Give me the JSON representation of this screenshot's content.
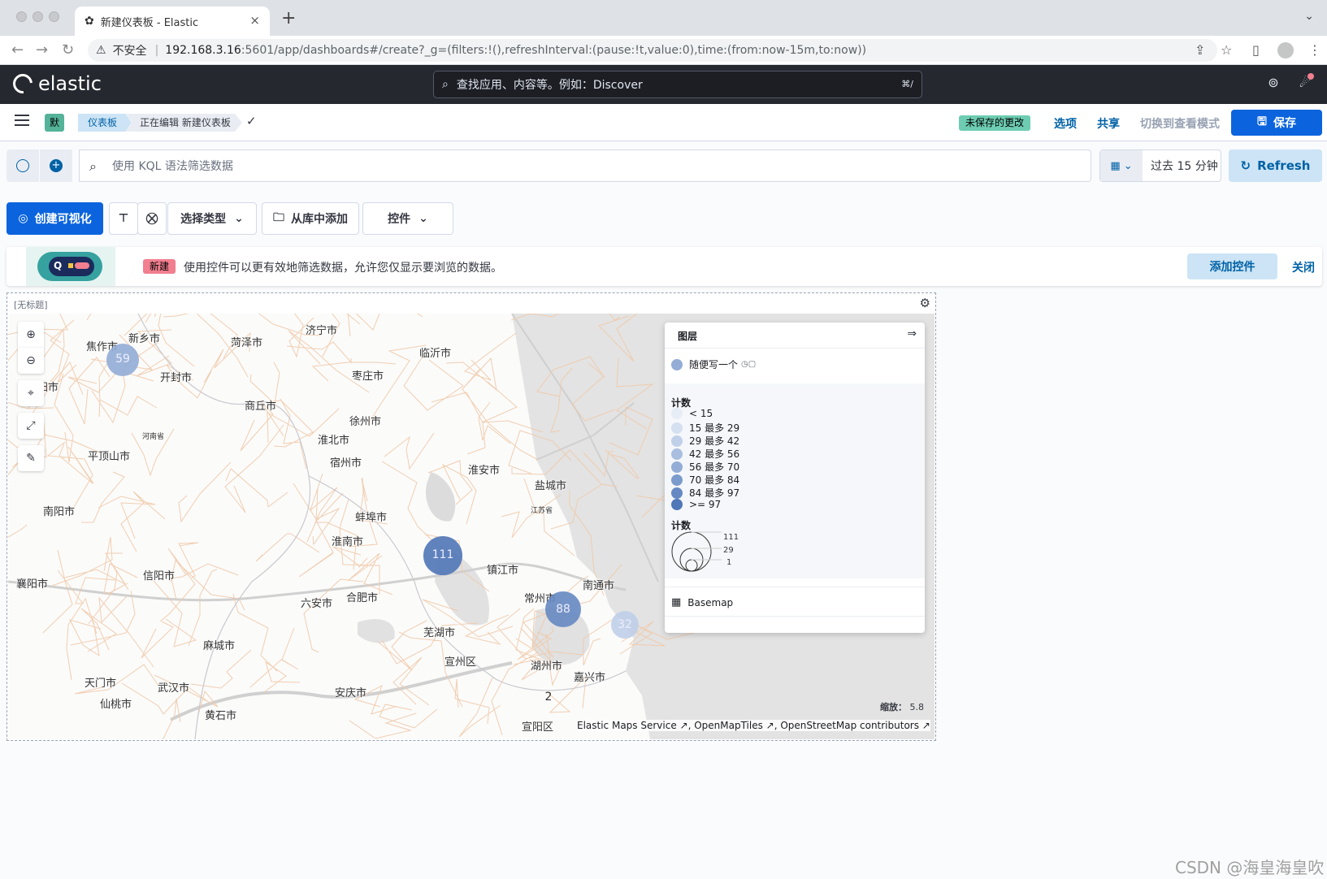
{
  "browser": {
    "tab_title": "新建仪表板 - Elastic",
    "tab_close": "×",
    "new_tab": "+",
    "security_label": "不安全",
    "url_host": "192.168.3.16",
    "url_path": ":5601/app/dashboards#/create?_g=(filters:!(),refreshInterval:(pause:!t,value:0),time:(from:now-15m,to:now))"
  },
  "kibana": {
    "logo_text": "elastic",
    "search_placeholder": "查找应用、内容等。例如：Discover",
    "search_shortcut": "⌘/"
  },
  "breadcrumb": {
    "space": "默",
    "dashboards": "仪表板",
    "current": "正在编辑 新建仪表板",
    "unsaved_badge": "未保存的更改",
    "options": "选项",
    "share": "共享",
    "switch_view": "切换到查看模式",
    "save": "保存"
  },
  "query": {
    "placeholder": "使用 KQL 语法筛选数据",
    "time_range": "过去 15 分钟",
    "refresh": "Refresh"
  },
  "toolbar": {
    "create_vis": "创建可视化",
    "select_type": "选择类型",
    "add_from_library": "从库中添加",
    "controls": "控件"
  },
  "callout": {
    "badge": "新建",
    "text": "使用控件可以更有效地筛选数据，允许您仅显示要浏览的数据。",
    "add_control": "添加控件",
    "close": "关闭"
  },
  "panel": {
    "title": "[无标题]"
  },
  "map": {
    "cities": [
      "焦作市",
      "新乡市",
      "菏泽市",
      "济宁市",
      "临沂市",
      "阳市",
      "开封市",
      "枣庄市",
      "商丘市",
      "徐州市",
      "淮北市",
      "宿州市",
      "平顶山市",
      "淮安市",
      "盐城市",
      "南阳市",
      "蚌埠市",
      "淮南市",
      "镇江市",
      "信阳市",
      "南通市",
      "襄阳市",
      "六安市",
      "合肥市",
      "常州市",
      "芜湖市",
      "麻城市",
      "宣州区",
      "湖州市",
      "嘉兴市",
      "天门市",
      "武汉市",
      "安庆市",
      "仙桃市",
      "黄石市",
      "宣阳区"
    ],
    "provinces": [
      "河南省",
      "江苏省"
    ],
    "clusters": [
      {
        "label": "59",
        "count": 59
      },
      {
        "label": "111",
        "count": 111
      },
      {
        "label": "88",
        "count": 88
      },
      {
        "label": "32",
        "count": 32
      },
      {
        "label": "2",
        "count": 2
      }
    ],
    "zoom_label": "缩放：",
    "zoom_value": "5.8",
    "attribution": "Elastic Maps Service ↗, OpenMapTiles ↗, OpenStreetMap contributors ↗"
  },
  "legend": {
    "header": "图层",
    "layer_name": "随便写一个",
    "color_title": "计数",
    "color_steps": [
      {
        "label": "< 15",
        "color": "#e6edf7"
      },
      {
        "label": "15 最多 29",
        "color": "#d5e0f0"
      },
      {
        "label": "29 最多 42",
        "color": "#c0d0e9"
      },
      {
        "label": "42 最多 56",
        "color": "#aabfe0"
      },
      {
        "label": "56 最多 70",
        "color": "#93add7"
      },
      {
        "label": "70 最多 84",
        "color": "#7c9bcd"
      },
      {
        "label": "84 最多 97",
        "color": "#6689c3"
      },
      {
        "label": ">= 97",
        "color": "#5077b8"
      }
    ],
    "size_title": "计数",
    "size_values": [
      "111",
      "29",
      "1"
    ],
    "basemap": "Basemap"
  },
  "watermark": "CSDN @海皇海皇吹"
}
